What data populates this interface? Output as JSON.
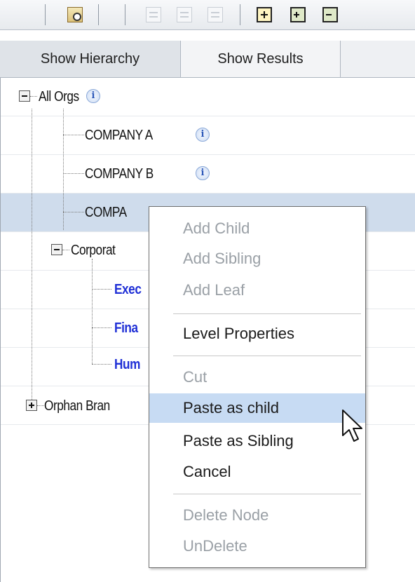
{
  "tabs": [
    {
      "label": "Show Hierarchy"
    },
    {
      "label": "Show Results"
    }
  ],
  "tree": {
    "root": {
      "label": "All Orgs"
    },
    "children": [
      {
        "label": "COMPANY A"
      },
      {
        "label": "COMPANY B"
      },
      {
        "label": "COMPA"
      },
      {
        "label": "Corporat"
      }
    ],
    "corporate_children": [
      {
        "label": "Exec"
      },
      {
        "label": "Fina"
      },
      {
        "label": "Hum"
      }
    ],
    "orphan": {
      "label": "Orphan Bran"
    }
  },
  "context_menu": {
    "items": [
      {
        "label": "Add Child",
        "enabled": false
      },
      {
        "label": "Add Sibling",
        "enabled": false
      },
      {
        "label": "Add Leaf",
        "enabled": false
      },
      {
        "label": "Level Properties",
        "enabled": true
      },
      {
        "label": "Cut",
        "enabled": false
      },
      {
        "label": "Paste as child",
        "enabled": true,
        "highlighted": true
      },
      {
        "label": "Paste as Sibling",
        "enabled": true
      },
      {
        "label": "Cancel",
        "enabled": true
      },
      {
        "label": "Delete Node",
        "enabled": false
      },
      {
        "label": "UnDelete",
        "enabled": false
      }
    ]
  },
  "icons": {
    "toolbar": [
      "find-icon",
      "add-child-disabled-icon",
      "add-sibling-disabled-icon",
      "add-leaf-disabled-icon",
      "add-icon",
      "expand-all-icon",
      "collapse-all-icon"
    ],
    "info": "info-icon",
    "cursor": "arrow-cursor-icon"
  },
  "colors": {
    "selected_row": "#cfdcec",
    "menu_highlight": "#c7dbf3",
    "link_blue": "#1f2fd6",
    "disabled_text": "#9aa0a6"
  }
}
